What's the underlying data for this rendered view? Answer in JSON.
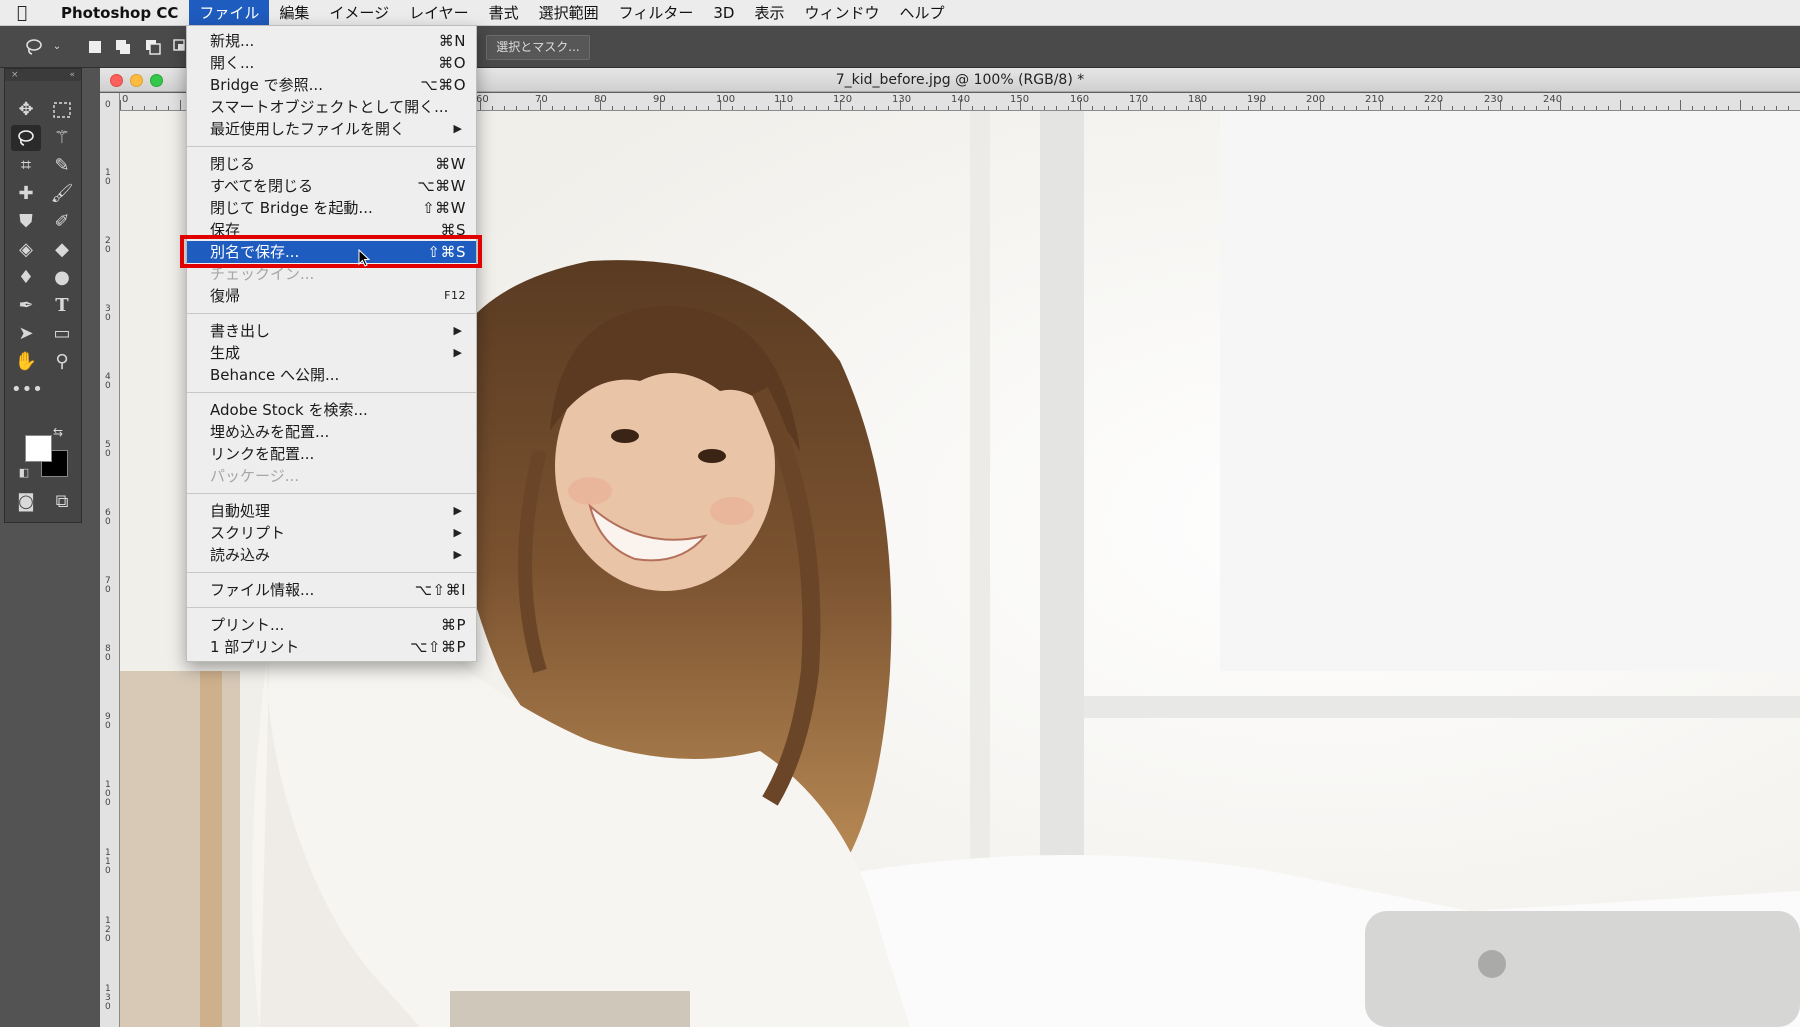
{
  "menubar": {
    "app_name": "Photoshop CC",
    "items": [
      "ファイル",
      "編集",
      "イメージ",
      "レイヤー",
      "書式",
      "選択範囲",
      "フィルター",
      "3D",
      "表示",
      "ウィンドウ",
      "ヘルプ"
    ]
  },
  "options_bar": {
    "select_and_mask": "選択とマスク..."
  },
  "document": {
    "title": "7_kid_before.jpg @ 100% (RGB/8) *",
    "ruler_top": [
      "0",
      "60",
      "70",
      "80",
      "90",
      "100",
      "110",
      "120",
      "130",
      "140",
      "150",
      "160",
      "170",
      "180",
      "190",
      "200",
      "210",
      "220",
      "230",
      "240"
    ],
    "ruler_left": [
      "0",
      "1 0",
      "2 0",
      "3 0",
      "4 0",
      "5 0",
      "6 0",
      "7 0",
      "8 0",
      "9 0",
      "1 0 0",
      "1 1 0",
      "1 2 0",
      "1 3 0"
    ]
  },
  "file_menu": {
    "groups": [
      [
        {
          "label": "新規...",
          "shortcut": "⌘N"
        },
        {
          "label": "開く...",
          "shortcut": "⌘O"
        },
        {
          "label": "Bridge で参照...",
          "shortcut": "⌥⌘O"
        },
        {
          "label": "スマートオブジェクトとして開く...",
          "shortcut": ""
        },
        {
          "label": "最近使用したファイルを開く",
          "shortcut": "",
          "submenu": true
        }
      ],
      [
        {
          "label": "閉じる",
          "shortcut": "⌘W"
        },
        {
          "label": "すべてを閉じる",
          "shortcut": "⌥⌘W"
        },
        {
          "label": "閉じて Bridge を起動...",
          "shortcut": "⇧⌘W"
        },
        {
          "label": "保存",
          "shortcut": "⌘S"
        },
        {
          "label": "別名で保存...",
          "shortcut": "⇧⌘S",
          "highlighted": true
        },
        {
          "label": "チェックイン...",
          "shortcut": "",
          "disabled": true
        },
        {
          "label": "復帰",
          "shortcut": "F12",
          "small": true
        }
      ],
      [
        {
          "label": "書き出し",
          "shortcut": "",
          "submenu": true
        },
        {
          "label": "生成",
          "shortcut": "",
          "submenu": true
        },
        {
          "label": "Behance へ公開...",
          "shortcut": ""
        }
      ],
      [
        {
          "label": "Adobe Stock を検索...",
          "shortcut": ""
        },
        {
          "label": "埋め込みを配置...",
          "shortcut": ""
        },
        {
          "label": "リンクを配置...",
          "shortcut": ""
        },
        {
          "label": "パッケージ...",
          "shortcut": "",
          "disabled": true
        }
      ],
      [
        {
          "label": "自動処理",
          "shortcut": "",
          "submenu": true
        },
        {
          "label": "スクリプト",
          "shortcut": "",
          "submenu": true
        },
        {
          "label": "読み込み",
          "shortcut": "",
          "submenu": true
        }
      ],
      [
        {
          "label": "ファイル情報...",
          "shortcut": "⌥⇧⌘I"
        }
      ],
      [
        {
          "label": "プリント...",
          "shortcut": "⌘P"
        },
        {
          "label": "1 部プリント",
          "shortcut": "⌥⇧⌘P"
        }
      ]
    ]
  },
  "colors": {
    "menu_highlight": "#1f5cbf",
    "annotation_box": "#e10000"
  }
}
